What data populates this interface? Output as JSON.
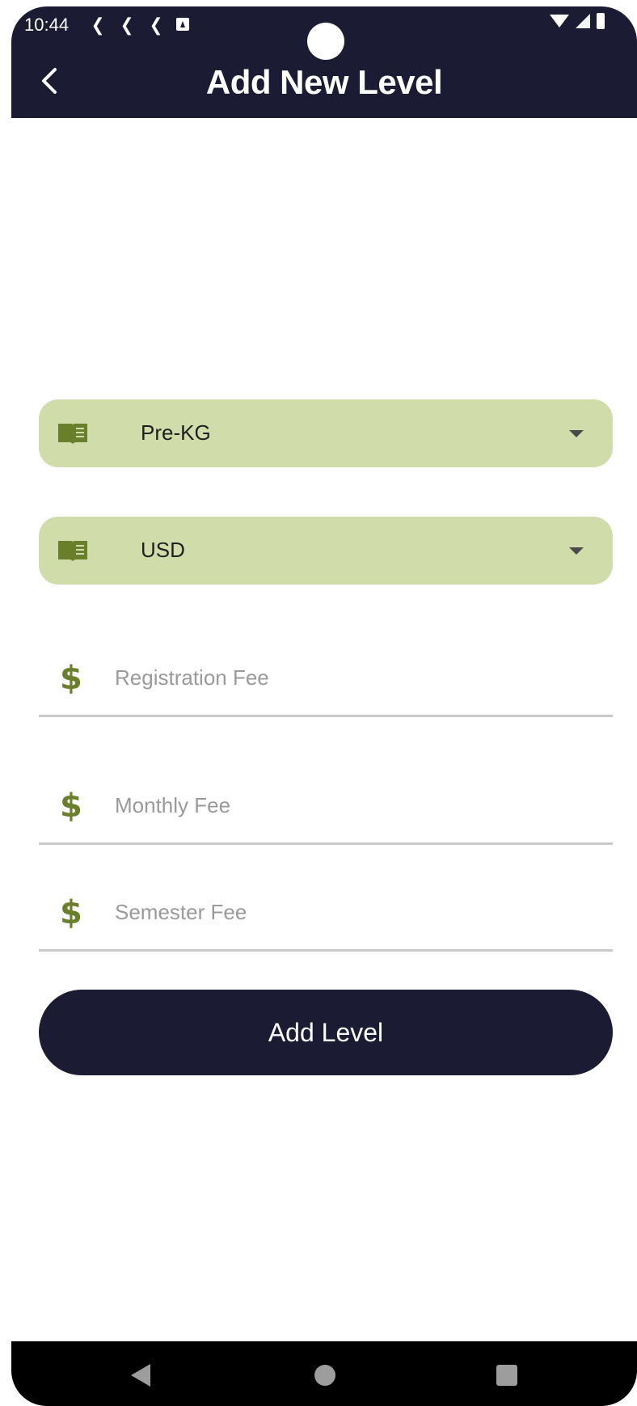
{
  "status_bar": {
    "time": "10:44",
    "left_icons": [
      "flutter-icon",
      "flutter-icon",
      "flutter-icon",
      "notification-icon"
    ],
    "right_icons": [
      "wifi-icon",
      "signal-icon",
      "battery-icon"
    ]
  },
  "header": {
    "title": "Add New Level",
    "back_icon": "chevron-left-icon",
    "background": "#1b1b33"
  },
  "form": {
    "level_select": {
      "value": "Pre-KG",
      "icon": "book-icon"
    },
    "currency_select": {
      "value": "USD",
      "icon": "book-icon"
    },
    "registration_fee": {
      "placeholder": "Registration Fee",
      "value": "",
      "icon": "dollar-icon"
    },
    "monthly_fee": {
      "placeholder": "Monthly Fee",
      "value": "",
      "icon": "dollar-icon"
    },
    "semester_fee": {
      "placeholder": "Semester Fee",
      "value": "",
      "icon": "dollar-icon"
    },
    "dropdown_background": "#d1dcab",
    "icon_color": "#6a7f2b"
  },
  "actions": {
    "submit_label": "Add Level",
    "submit_color": "#1b1b33"
  },
  "nav_bar": {
    "icons": [
      "back-icon",
      "home-icon",
      "recents-icon"
    ]
  }
}
